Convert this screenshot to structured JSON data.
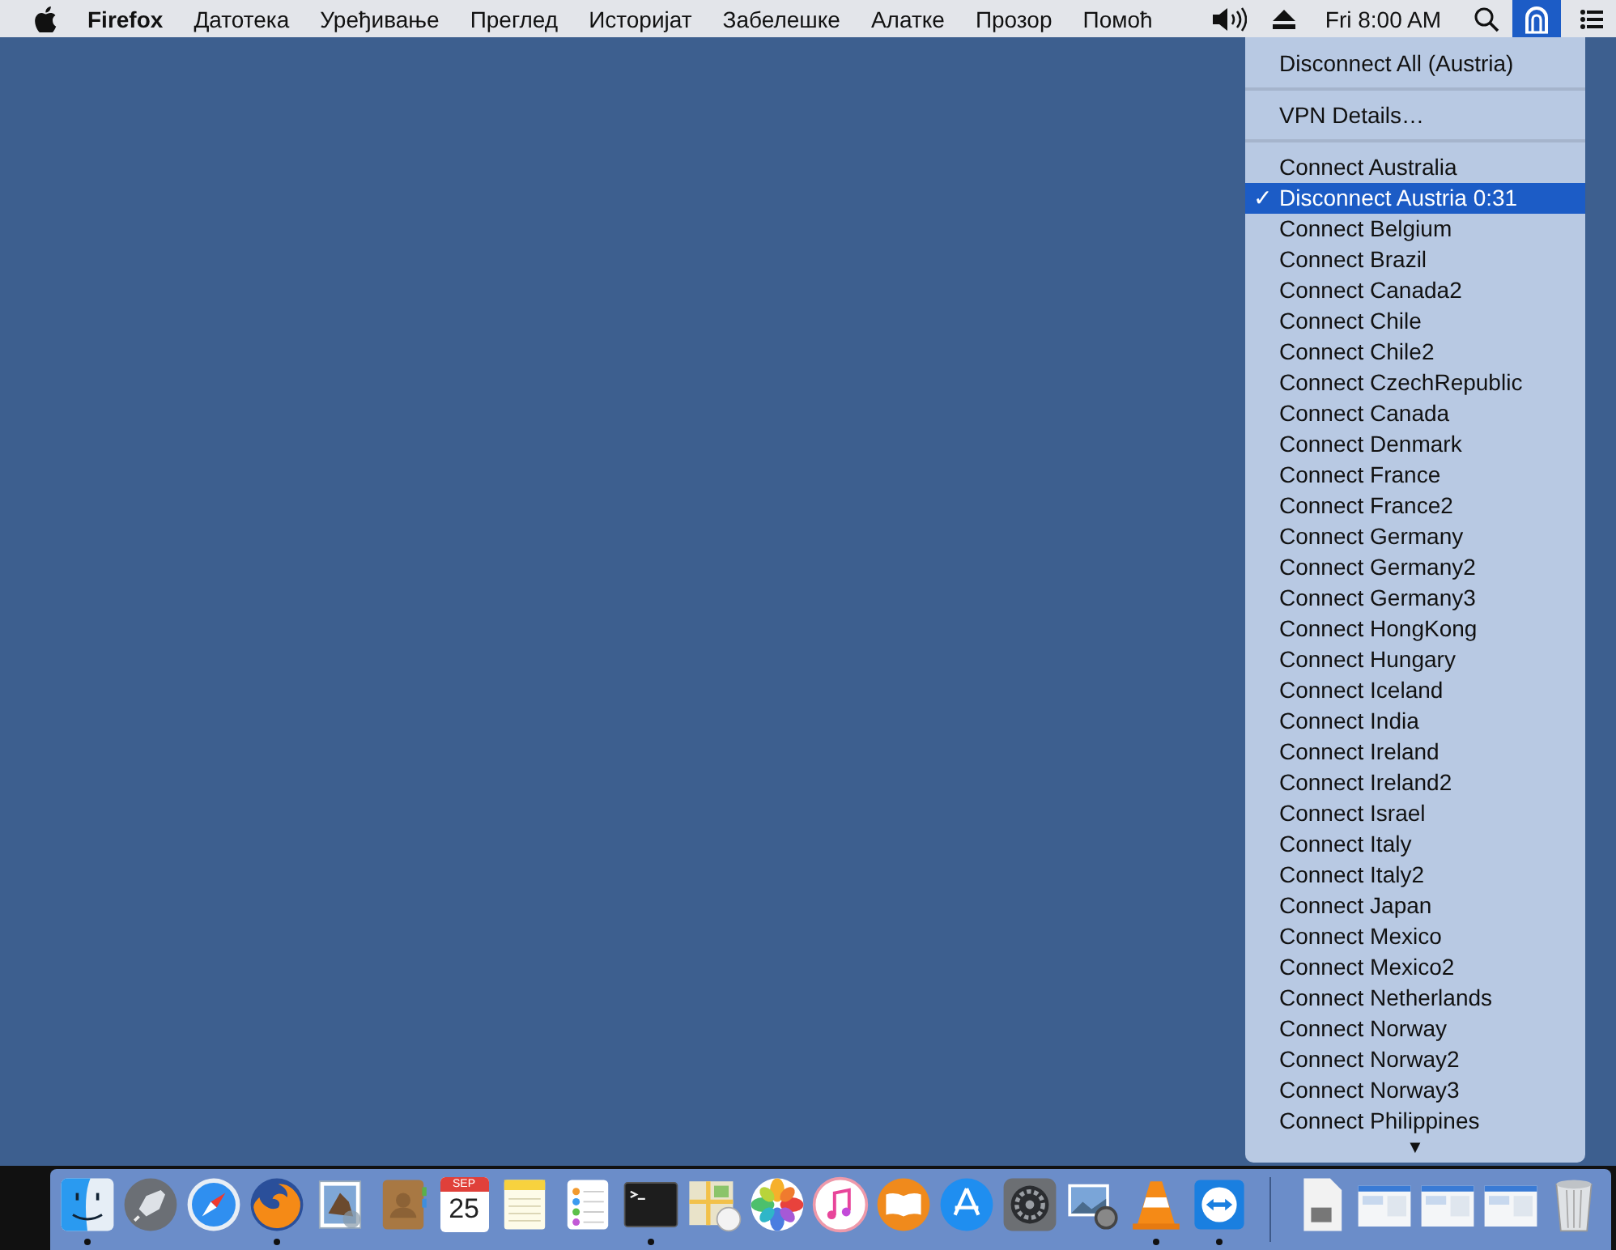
{
  "menu_bar": {
    "app_name": "Firefox",
    "menus": [
      "Датотека",
      "Уређивање",
      "Преглед",
      "Историјат",
      "Забелешке",
      "Алатке",
      "Прозор",
      "Помоћ"
    ],
    "status_items": [
      {
        "kind": "volume",
        "selected": false
      },
      {
        "kind": "eject",
        "selected": false
      },
      {
        "kind": "clock",
        "text": "Fri 8:00 AM",
        "selected": false
      },
      {
        "kind": "search",
        "selected": false
      },
      {
        "kind": "vpn",
        "selected": true
      },
      {
        "kind": "list",
        "selected": false
      }
    ]
  },
  "vpn_menu": {
    "sections": [
      [
        {
          "label": "Disconnect All (Austria)",
          "selected": false
        }
      ],
      [
        {
          "label": "VPN Details…",
          "selected": false
        }
      ],
      [
        {
          "label": "Connect Australia",
          "selected": false
        },
        {
          "label": "Disconnect Austria 0:31",
          "selected": true
        },
        {
          "label": "Connect Belgium",
          "selected": false
        },
        {
          "label": "Connect Brazil",
          "selected": false
        },
        {
          "label": "Connect Canada2",
          "selected": false
        },
        {
          "label": "Connect Chile",
          "selected": false
        },
        {
          "label": "Connect Chile2",
          "selected": false
        },
        {
          "label": "Connect CzechRepublic",
          "selected": false
        },
        {
          "label": "Connect Canada",
          "selected": false
        },
        {
          "label": "Connect Denmark",
          "selected": false
        },
        {
          "label": "Connect France",
          "selected": false
        },
        {
          "label": "Connect France2",
          "selected": false
        },
        {
          "label": "Connect Germany",
          "selected": false
        },
        {
          "label": "Connect Germany2",
          "selected": false
        },
        {
          "label": "Connect Germany3",
          "selected": false
        },
        {
          "label": "Connect HongKong",
          "selected": false
        },
        {
          "label": "Connect Hungary",
          "selected": false
        },
        {
          "label": "Connect Iceland",
          "selected": false
        },
        {
          "label": "Connect India",
          "selected": false
        },
        {
          "label": "Connect Ireland",
          "selected": false
        },
        {
          "label": "Connect Ireland2",
          "selected": false
        },
        {
          "label": "Connect Israel",
          "selected": false
        },
        {
          "label": "Connect Italy",
          "selected": false
        },
        {
          "label": "Connect Italy2",
          "selected": false
        },
        {
          "label": "Connect Japan",
          "selected": false
        },
        {
          "label": "Connect Mexico",
          "selected": false
        },
        {
          "label": "Connect Mexico2",
          "selected": false
        },
        {
          "label": "Connect Netherlands",
          "selected": false
        },
        {
          "label": "Connect Norway",
          "selected": false
        },
        {
          "label": "Connect Norway2",
          "selected": false
        },
        {
          "label": "Connect Norway3",
          "selected": false
        },
        {
          "label": "Connect Philippines",
          "selected": false
        }
      ]
    ],
    "check_mark": "✓",
    "scroll_indicator": "▼"
  },
  "dock": {
    "items": [
      {
        "kind": "finder",
        "running": true
      },
      {
        "kind": "launchpad",
        "running": false
      },
      {
        "kind": "safari",
        "running": false
      },
      {
        "kind": "firefox",
        "running": true
      },
      {
        "kind": "mail",
        "running": false
      },
      {
        "kind": "contacts",
        "running": false
      },
      {
        "kind": "calendar",
        "running": false,
        "month": "SEP",
        "day": "25"
      },
      {
        "kind": "notes",
        "running": false
      },
      {
        "kind": "reminders",
        "running": false
      },
      {
        "kind": "terminal",
        "running": true
      },
      {
        "kind": "maps",
        "running": false
      },
      {
        "kind": "photos",
        "running": false
      },
      {
        "kind": "itunes",
        "running": false
      },
      {
        "kind": "ibooks",
        "running": false
      },
      {
        "kind": "appstore",
        "running": false
      },
      {
        "kind": "preferences",
        "running": false
      },
      {
        "kind": "preview",
        "running": false
      },
      {
        "kind": "vlc",
        "running": true
      },
      {
        "kind": "teamviewer",
        "running": true
      },
      {
        "kind": "separator"
      },
      {
        "kind": "document",
        "running": false
      },
      {
        "kind": "window",
        "running": false
      },
      {
        "kind": "window",
        "running": false
      },
      {
        "kind": "window",
        "running": false
      },
      {
        "kind": "trash",
        "running": false
      }
    ]
  }
}
